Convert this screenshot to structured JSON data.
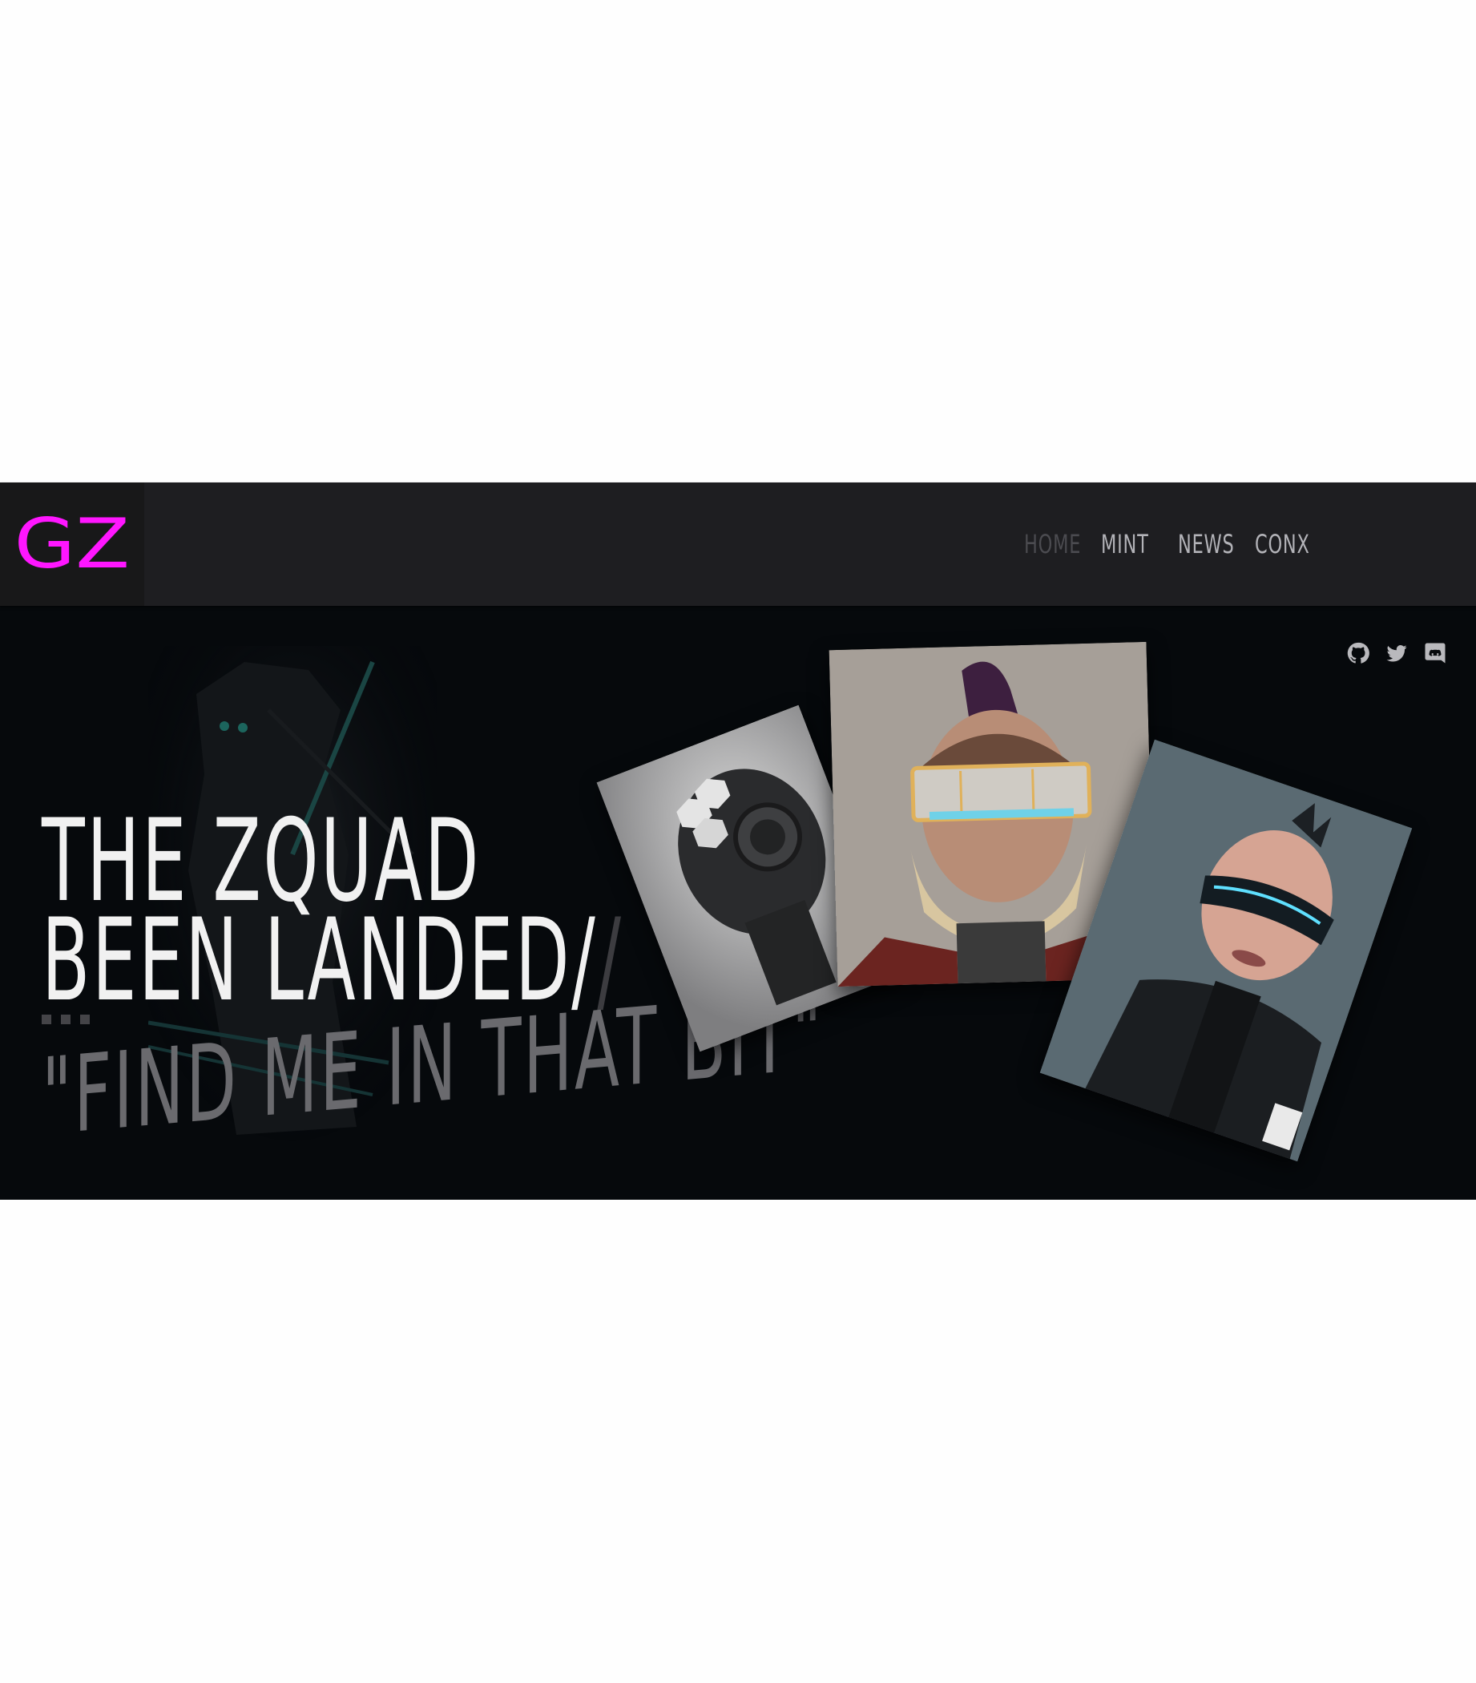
{
  "header": {
    "logo_text": "GZ",
    "nav": [
      "HOME",
      "MINT",
      "NEWS",
      "CONX"
    ],
    "active_nav": "HOME"
  },
  "hero": {
    "headline_line1": "THE ZQUAD",
    "headline_line2": "BEEN LANDED/",
    "headline_slash": "/",
    "tagline": "\"FIND ME IN THAT BIT\""
  },
  "social": {
    "icons": [
      "github-icon",
      "twitter-icon",
      "discord-icon"
    ]
  },
  "colors": {
    "logo": "#ff16ff",
    "navbar": "#1e1e21",
    "hero_bg": "#06090c"
  }
}
